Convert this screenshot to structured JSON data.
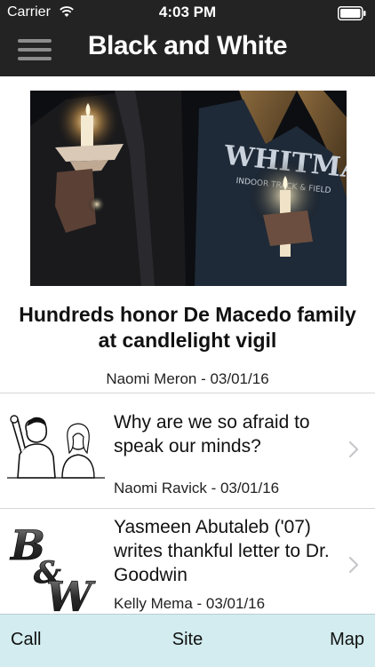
{
  "status": {
    "carrier": "Carrier",
    "time": "4:03 PM"
  },
  "nav": {
    "title": "Black and White"
  },
  "featured": {
    "headline": "Hundreds honor De Macedo family at candlelight vigil",
    "byline": "Naomi Meron - 03/01/16",
    "photo_text": "WHITMAN",
    "photo_subtext": "INDOOR TRACK & FIELD"
  },
  "articles": [
    {
      "title": "Why are we so afraid to speak our minds?",
      "byline": "Naomi Ravick - 03/01/16"
    },
    {
      "title": "Yasmeen Abutaleb ('07) writes thankful letter to Dr. Goodwin",
      "byline": "Kelly Mema - 03/01/16",
      "logo_text": "B&W"
    }
  ],
  "tabs": {
    "call": "Call",
    "site": "Site",
    "map": "Map"
  }
}
